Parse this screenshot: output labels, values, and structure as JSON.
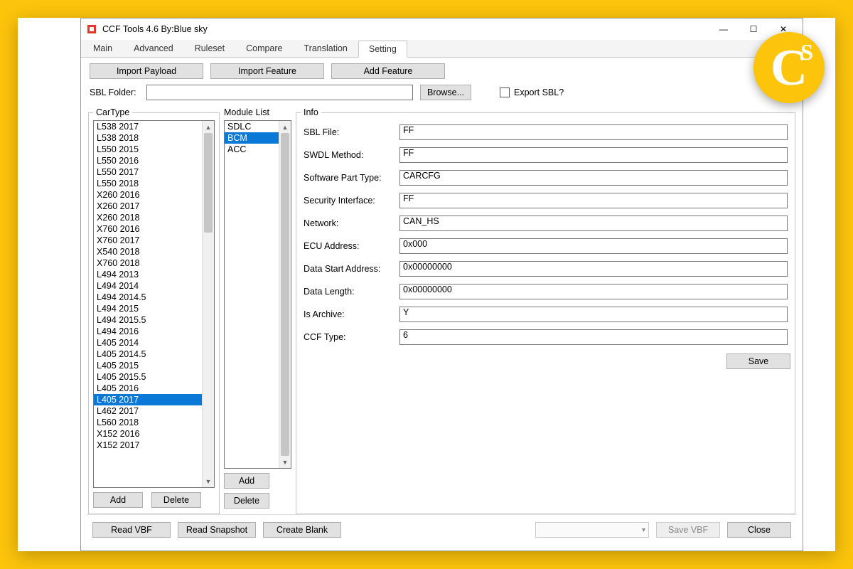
{
  "window": {
    "title": "CCF Tools 4.6  By:Blue sky"
  },
  "tabs": [
    "Main",
    "Advanced",
    "Ruleset",
    "Compare",
    "Translation",
    "Setting"
  ],
  "active_tab": "Setting",
  "buttons": {
    "import_payload": "Import Payload",
    "import_feature": "Import Feature",
    "add_feature": "Add Feature",
    "browse": "Browse...",
    "add": "Add",
    "delete": "Delete",
    "save": "Save",
    "read_vbf": "Read VBF",
    "read_snapshot": "Read Snapshot",
    "create_blank": "Create Blank",
    "save_vbf": "Save VBF",
    "close": "Close"
  },
  "sbl": {
    "label": "SBL Folder:",
    "value": "",
    "export_label": "Export SBL?"
  },
  "cartype": {
    "legend": "CarType",
    "items": [
      "L538 2017",
      "L538 2018",
      "L550 2015",
      "L550 2016",
      "L550 2017",
      "L550 2018",
      "X260 2016",
      "X260 2017",
      "X260 2018",
      "X760 2016",
      "X760 2017",
      "X540 2018",
      "X760 2018",
      "L494 2013",
      "L494 2014",
      "L494 2014.5",
      "L494 2015",
      "L494 2015.5",
      "L494 2016",
      "L405 2014",
      "L405 2014.5",
      "L405 2015",
      "L405 2015.5",
      "L405 2016",
      "L405 2017",
      "L462 2017",
      "L560 2018",
      "X152 2016",
      "X152 2017"
    ],
    "selected": "L405 2017"
  },
  "module_list": {
    "label": "Module List",
    "items": [
      "SDLC",
      "BCM",
      "ACC"
    ],
    "selected": "BCM"
  },
  "info": {
    "legend": "Info",
    "fields": [
      {
        "label": "SBL File:",
        "value": "FF"
      },
      {
        "label": "SWDL Method:",
        "value": "FF"
      },
      {
        "label": "Software Part Type:",
        "value": "CARCFG"
      },
      {
        "label": "Security Interface:",
        "value": "FF"
      },
      {
        "label": "Network:",
        "value": "CAN_HS"
      },
      {
        "label": "ECU Address:",
        "value": "0x000"
      },
      {
        "label": "Data Start Address:",
        "value": "0x00000000"
      },
      {
        "label": "Data Length:",
        "value": "0x00000000"
      },
      {
        "label": "Is Archive:",
        "value": "Y"
      },
      {
        "label": "CCF Type:",
        "value": "6"
      }
    ]
  }
}
